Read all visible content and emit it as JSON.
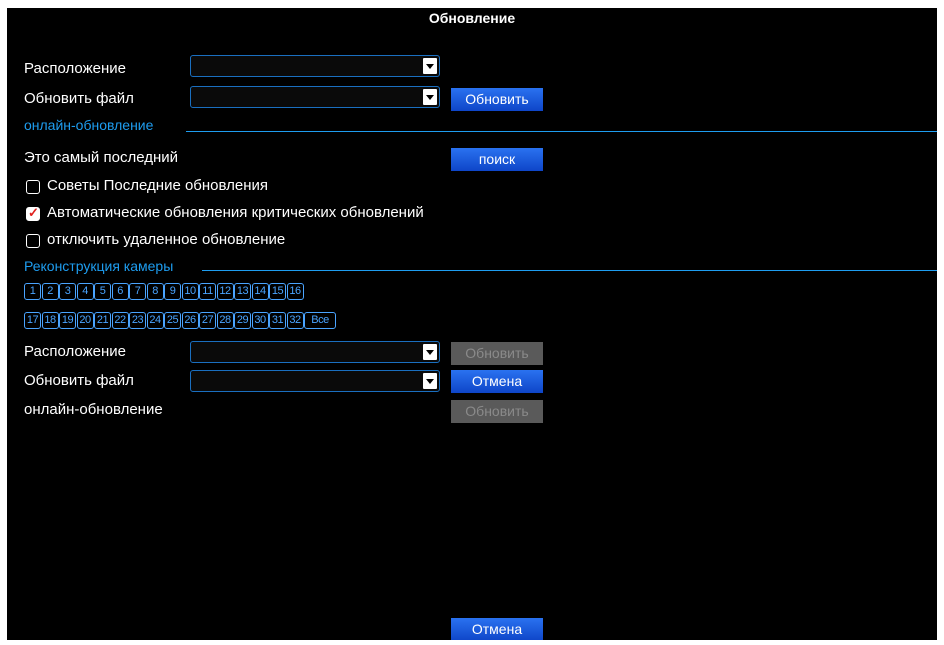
{
  "title": "Обновление",
  "local": {
    "location_label": "Расположение",
    "location_value": "",
    "file_label": "Обновить файл",
    "file_value": "",
    "update_button": "Обновить"
  },
  "online": {
    "section_title": "онлайн-обновление",
    "status_text": "Это самый последний",
    "search_button": "поиск",
    "checkboxes": [
      {
        "label": "Советы Последние обновления",
        "checked": false
      },
      {
        "label": "Автоматические обновления критических обновлений",
        "checked": true
      },
      {
        "label": "отключить удаленное обновление",
        "checked": false
      }
    ]
  },
  "camera": {
    "section_title": "Реконструкция камеры",
    "channels": [
      "1",
      "2",
      "3",
      "4",
      "5",
      "6",
      "7",
      "8",
      "9",
      "10",
      "11",
      "12",
      "13",
      "14",
      "15",
      "16",
      "17",
      "18",
      "19",
      "20",
      "21",
      "22",
      "23",
      "24",
      "25",
      "26",
      "27",
      "28",
      "29",
      "30",
      "31",
      "32"
    ],
    "all_label": "Все",
    "location_label": "Расположение",
    "location_value": "",
    "update_button": "Обновить",
    "file_label": "Обновить файл",
    "file_value": "",
    "cancel_button": "Отмена",
    "online_label": "онлайн-обновление",
    "online_update_button": "Обновить"
  },
  "footer": {
    "cancel_button": "Отмена"
  },
  "colors": {
    "background": "#000000",
    "accent": "#1e9df0",
    "button_blue": "#1a5ae0",
    "button_disabled": "#5a5a5a",
    "check_mark": "#e0221f"
  }
}
